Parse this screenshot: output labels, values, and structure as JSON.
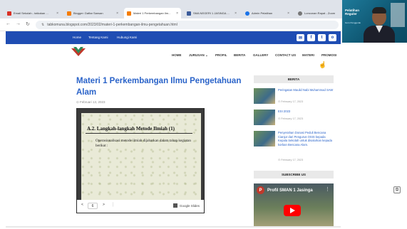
{
  "browser": {
    "tabs": [
      {
        "label": "Email Sekolah - tatkokan ..."
      },
      {
        "label": "Blogger: Daftar Sansan"
      },
      {
        "label": "Materi 1 Perkembangan Ilm..."
      },
      {
        "label": "SMA NEGERI 1 JASINGA ..."
      },
      {
        "label": "Admin Pelatihan"
      },
      {
        "label": "Lonconan Rapat - Zoom"
      }
    ],
    "url": "tabkomuna.blogspot.com/2023/02/materi-1-perkembangan-ilmu-pengetahuan.html"
  },
  "webcam": {
    "headline_1": "Pelatihan",
    "headline_2": "Reguler",
    "caption": "Guru Penggerak"
  },
  "site": {
    "top_links": [
      "Home",
      "Tentang Kami",
      "Hubungi Kami"
    ],
    "social": [
      "f",
      "f",
      "t",
      "o"
    ],
    "nav": [
      "HOME",
      "JURUSAN ⌄",
      "PROFIL",
      "BERITA",
      "GALLERY",
      "CONTACT US",
      "MATERI",
      "PROMOSI"
    ]
  },
  "article": {
    "title": "Materi 1 Perkembangan Ilmu Pengetahuan Alam",
    "date": "⊙ Februari 13, 2023"
  },
  "slide": {
    "heading": "A.2.  Langkah-langkah Metode Ilmiah (1)",
    "body": "Operasionalisasi metode ilmiah dijabarkan dalam tahap kegiatan berikut :",
    "prev": "<",
    "page": "6",
    "next": ">",
    "more": "⋮",
    "brand": "Google Slides"
  },
  "sidebar": {
    "berita_header": "BERITA",
    "posts": [
      {
        "title": "Peringatan Maulid Nabi Muhammad SAW",
        "date": "⊙ February 17, 2023"
      },
      {
        "title": "ESI 2023",
        "date": "⊙ February 17, 2023"
      },
      {
        "title": "Penyerahan Donasi Peduli Bencana Cianjur dari Pengurus OSIS kepada Kepala Sekolah untuk disalurkan kepada korban Bencana Alam.",
        "date": "⊙ February 17, 2023"
      }
    ],
    "subscribe_header": "SUBSCRIBE US",
    "video_title": "Profil SMAN 1 Jasinga",
    "video_logo": "P",
    "video_more": "⋮"
  },
  "colors": {
    "brand_blue": "#1f4db3",
    "link_blue": "#2a63c9"
  }
}
